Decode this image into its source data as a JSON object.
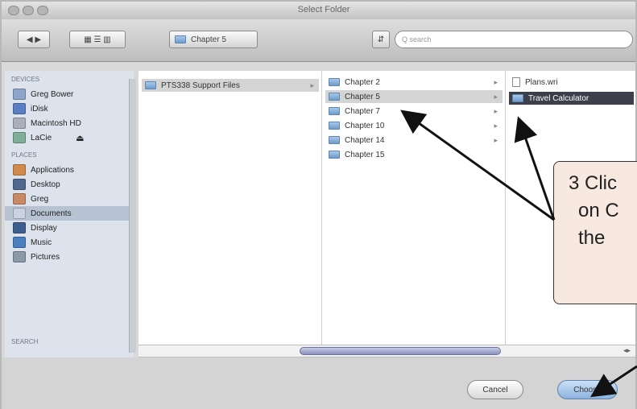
{
  "window": {
    "title": "Select Folder"
  },
  "toolbar": {
    "back_forward": "◀ ▶",
    "view_buttons": "▦ ☰ ▥",
    "location": "Chapter 5",
    "path_button": "⇵",
    "search_placeholder": "Q search"
  },
  "sidebar": {
    "sections": [
      {
        "label": "DEVICES"
      },
      {
        "label": "PLACES"
      },
      {
        "label": "SEARCH"
      }
    ],
    "items": [
      {
        "label": "Greg Bower",
        "color": "#8fa6c8"
      },
      {
        "label": "iDisk",
        "color": "#5b7fc3"
      },
      {
        "label": "Macintosh HD",
        "color": "#a9b0bb"
      },
      {
        "label": "LaCie",
        "color": "#7faf9a"
      },
      {
        "label": "Applications",
        "color": "#d08a4a"
      },
      {
        "label": "Desktop",
        "color": "#52698f"
      },
      {
        "label": "Greg",
        "color": "#c98a66"
      },
      {
        "label": "Documents",
        "color": "#c9d3e2"
      },
      {
        "label": "Display",
        "color": "#3f5f8f"
      },
      {
        "label": "Music",
        "color": "#4a7fbf"
      },
      {
        "label": "Pictures",
        "color": "#8c9aa8"
      }
    ]
  },
  "columns": {
    "col1": [
      {
        "label": "PTS338 Support Files"
      }
    ],
    "col2": [
      {
        "label": "Chapter 2"
      },
      {
        "label": "Chapter 5"
      },
      {
        "label": "Chapter 7"
      },
      {
        "label": "Chapter 10"
      },
      {
        "label": "Chapter 14"
      },
      {
        "label": "Chapter 15"
      }
    ],
    "col3": [
      {
        "label": "Plans.wri"
      },
      {
        "label": "Travel Calculator"
      }
    ]
  },
  "buttons": {
    "cancel": "Cancel",
    "choose": "Choose"
  },
  "callout": {
    "line1": "3  Clic",
    "line2": "on C",
    "line3": "the"
  }
}
